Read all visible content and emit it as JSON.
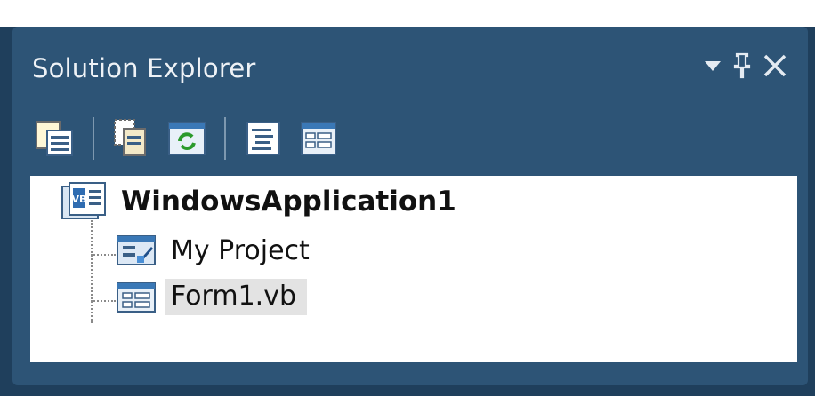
{
  "panel": {
    "title": "Solution Explorer",
    "controls": [
      {
        "name": "window-position-dropdown-icon",
        "glyph": "▾"
      },
      {
        "name": "pin-icon",
        "glyph": "𝟰"
      },
      {
        "name": "close-icon",
        "glyph": "✕"
      }
    ]
  },
  "toolbar": {
    "buttons": [
      {
        "name": "properties-button",
        "icon": "properties-icon"
      },
      {
        "name": "show-all-files-button",
        "icon": "show-all-files-icon"
      },
      {
        "name": "refresh-button",
        "icon": "refresh-icon"
      },
      {
        "name": "view-code-button",
        "icon": "view-code-icon"
      },
      {
        "name": "view-designer-button",
        "icon": "view-designer-icon"
      }
    ]
  },
  "tree": {
    "root": {
      "label": "WindowsApplication1",
      "icon": "vb-project-icon"
    },
    "children": [
      {
        "label": "My Project",
        "icon": "my-project-icon",
        "selected": false
      },
      {
        "label": "Form1.vb",
        "icon": "form-icon",
        "selected": true
      }
    ]
  },
  "colors": {
    "panel_background": "#2d5476",
    "title_text": "#eef2f6",
    "tree_background": "#ffffff",
    "selection": "#e3e3e3"
  }
}
